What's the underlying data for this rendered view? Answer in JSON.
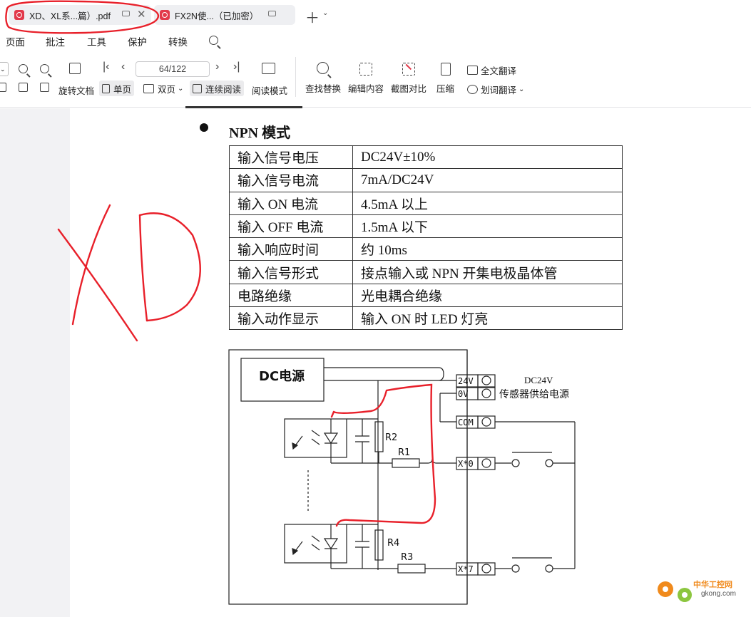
{
  "tabs": [
    {
      "title": "XD、XL系...篇）.pdf",
      "active": true
    },
    {
      "title": "FX2N使...（已加密）",
      "active": false
    }
  ],
  "menu": [
    "页面",
    "批注",
    "工具",
    "保护",
    "转换"
  ],
  "toolbar": {
    "page_indicator": "64/122",
    "rotate_label": "旋转文档",
    "single_page_label": "单页",
    "double_page_label": "双页",
    "continuous_label": "连续阅读",
    "reading_mode_label": "阅读模式",
    "find_replace_label": "查找替换",
    "edit_content_label": "编辑内容",
    "screenshot_compare_label": "截图对比",
    "compress_label": "压缩",
    "full_translate_label": "全文翻译",
    "word_translate_label": "划词翻译"
  },
  "document": {
    "section_title": "NPN 模式",
    "spec_table": [
      [
        "输入信号电压",
        "DC24V±10%"
      ],
      [
        "输入信号电流",
        "7mA/DC24V"
      ],
      [
        "输入 ON 电流",
        "4.5mA 以上"
      ],
      [
        "输入 OFF 电流",
        "1.5mA 以下"
      ],
      [
        "输入响应时间",
        "约 10ms"
      ],
      [
        "输入信号形式",
        "接点输入或 NPN 开集电极晶体管"
      ],
      [
        "电路绝缘",
        "光电耦合绝缘"
      ],
      [
        "输入动作显示",
        "输入 ON 时 LED 灯亮"
      ]
    ],
    "diagram": {
      "power_label": "DC电源",
      "terminals": [
        "24V",
        "0V",
        "COM",
        "X*0",
        "X*7"
      ],
      "voltage_note": "DC24V",
      "sensor_note": "传感器供给电源",
      "resistors": [
        "R2",
        "R1",
        "R4",
        "R3"
      ]
    }
  },
  "annotation": {
    "handwritten_text": "XD"
  },
  "watermark": {
    "line1": "中华工控网",
    "line2": "gkong.com"
  },
  "colors": {
    "annotation_red": "#e8202a",
    "tab_pdf_icon": "#e2394b"
  }
}
